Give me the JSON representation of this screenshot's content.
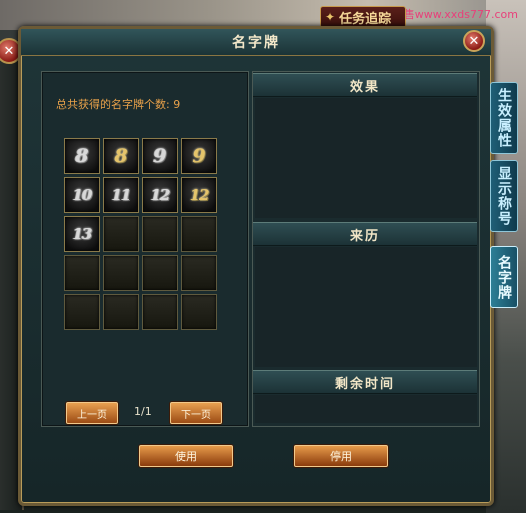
{
  "hud": {
    "quest_tab": "任务追踪",
    "watermark": "小雪代售www.xxds777.com"
  },
  "window": {
    "title": "名字牌"
  },
  "left_panel": {
    "count_label": "总共获得的名字牌个数: 9",
    "slots": [
      {
        "glyph": "8",
        "style": "silver"
      },
      {
        "glyph": "8",
        "style": "gold"
      },
      {
        "glyph": "9",
        "style": "silver"
      },
      {
        "glyph": "9",
        "style": "gold"
      },
      {
        "glyph": "10",
        "style": "silver"
      },
      {
        "glyph": "11",
        "style": "silver"
      },
      {
        "glyph": "12",
        "style": "silver"
      },
      {
        "glyph": "12",
        "style": "gold"
      },
      {
        "glyph": "13",
        "style": "silver"
      },
      {
        "glyph": "",
        "style": "empty"
      },
      {
        "glyph": "",
        "style": "empty"
      },
      {
        "glyph": "",
        "style": "empty"
      },
      {
        "glyph": "",
        "style": "empty"
      },
      {
        "glyph": "",
        "style": "empty"
      },
      {
        "glyph": "",
        "style": "empty"
      },
      {
        "glyph": "",
        "style": "empty"
      },
      {
        "glyph": "",
        "style": "empty"
      },
      {
        "glyph": "",
        "style": "empty"
      },
      {
        "glyph": "",
        "style": "empty"
      },
      {
        "glyph": "",
        "style": "empty"
      }
    ],
    "prev_label": "上一页",
    "page_indicator": "1/1",
    "next_label": "下一页"
  },
  "right_panel": {
    "effect_header": "效果",
    "origin_header": "来历",
    "time_header": "剩余时间"
  },
  "buttons": {
    "use_label": "使用",
    "disable_label": "停用"
  },
  "side_tabs": [
    {
      "label": "生效属性",
      "active": false
    },
    {
      "label": "显示称号",
      "active": false
    },
    {
      "label": "名字牌",
      "active": true
    }
  ],
  "colors": {
    "accent_gold": "#b89c5a",
    "count_text": "#e9a24a",
    "button_orange": "#e79b4a",
    "tab_blue": "#1f5f77"
  }
}
